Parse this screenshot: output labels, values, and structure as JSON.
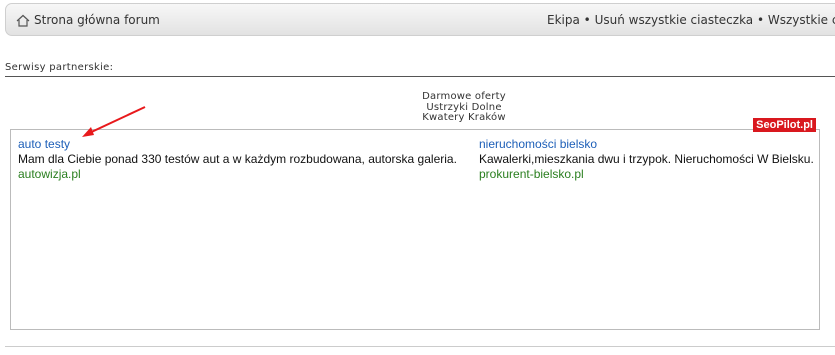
{
  "navbar": {
    "home_label": "Strona główna forum",
    "team_label": "Ekipa",
    "separator": "•",
    "delete_cookies_label": "Usuń wszystkie ciasteczka",
    "all_times_label": "Wszystkie cza"
  },
  "partners": {
    "heading": "Serwisy partnerskie:",
    "center_links": [
      "Darmowe oferty",
      "Ustrzyki Dolne",
      "Kwatery Kraków"
    ]
  },
  "ads": [
    {
      "title": "auto testy",
      "description": "Mam dla Ciebie ponad 330 testów aut a w każdym rozbudowana, autorska galeria.",
      "url": "autowizja.pl"
    },
    {
      "title": "nieruchomości bielsko",
      "description": "Kawalerki,mieszkania dwu i trzypok. Nieruchomości W Bielsku.",
      "url": "prokurent-bielsko.pl"
    }
  ],
  "seopilot_badge": "SeoPilot.pl",
  "colors": {
    "ad_title": "#1d5fb8",
    "ad_url": "#2a7f1f",
    "badge": "#d9181e",
    "arrow": "#e8191c"
  },
  "icons": [
    "home-icon",
    "red-arrow-annotation"
  ]
}
